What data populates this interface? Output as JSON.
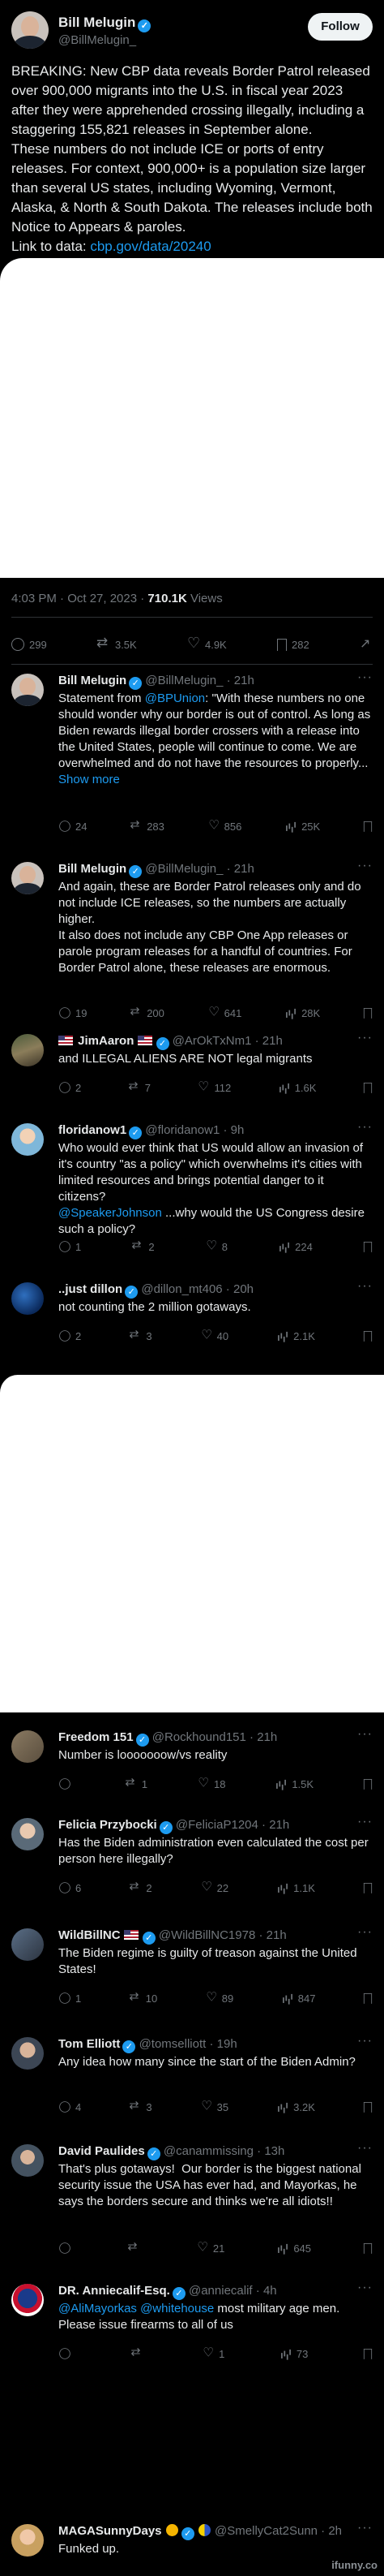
{
  "main_post": {
    "author_name": "Bill Melugin",
    "author_handle": "@BillMelugin_",
    "follow_label": "Follow",
    "text_part1": "BREAKING: New CBP data reveals Border Patrol released over 900,000 migrants into the U.S. in fiscal year 2023 after they were apprehended crossing illegally, including a staggering 155,821 releases in September alone.\nThese numbers do not include ICE or ports of entry releases. For context, 900,000+ is a population size larger than several US states, including Wyoming, Vermont, Alaska, & North & South Dakota. The releases include both Notice to Appears & paroles.\nLink to data: ",
    "link_text": "cbp.gov/data/20240",
    "timestamp": "4:03 PM · Oct 27, 2023 · ",
    "views_count": "710.1K",
    "views_label": " Views",
    "stats": {
      "replies": "299",
      "retweets": "3.5K",
      "likes": "4.9K",
      "bookmarks": "282"
    }
  },
  "replies": [
    {
      "name": "Bill Melugin",
      "handle": "@BillMelugin_",
      "time": "21h",
      "text_before": "Statement from ",
      "mention": "@BPUnion",
      "text_after": ": \"With these numbers no one should wonder why our border is out of control. As long as Biden rewards illegal border crossers with a release into the United States, people will continue to come. We are overwhelmed and do not have the resources to properly...",
      "show_more": "Show more",
      "stats": {
        "replies": "24",
        "retweets": "283",
        "likes": "856",
        "views": "25K"
      }
    },
    {
      "name": "Bill Melugin",
      "handle": "@BillMelugin_",
      "time": "21h",
      "text": "And again, these are Border Patrol releases only and do not include ICE releases, so the numbers are actually higher.\nIt also does not include any CBP One App releases or parole program releases for a handful of countries. For Border Patrol alone, these releases are enormous.",
      "stats": {
        "replies": "19",
        "retweets": "200",
        "likes": "641",
        "views": "28K"
      }
    },
    {
      "name": "JimAaron",
      "handle": "@ArOkTxNm1",
      "time": "21h",
      "text": "and ILLEGAL ALIENS ARE NOT legal migrants",
      "stats": {
        "replies": "2",
        "retweets": "7",
        "likes": "112",
        "views": "1.6K"
      }
    },
    {
      "name": "floridanow1",
      "handle": "@floridanow1",
      "time": "9h",
      "text_before": "Who would ever think that US would allow an invasion of it's country \"as a policy\" which overwhelms it's cities with limited resources and brings potential danger to it citizens?\n",
      "mention": "@SpeakerJohnson",
      "text_after": " ...why would the US Congress desire such a policy?",
      "stats": {
        "replies": "1",
        "retweets": "2",
        "likes": "8",
        "views": "224"
      }
    },
    {
      "name": "..just dillon",
      "handle": "@dillon_mt406",
      "time": "20h",
      "text": "not counting the 2 million gotaways.",
      "stats": {
        "replies": "2",
        "retweets": "3",
        "likes": "40",
        "views": "2.1K"
      }
    },
    {
      "name": "Freedom 151",
      "handle": "@Rockhound151",
      "time": "21h",
      "text": "Number is looooooow/vs reality",
      "stats": {
        "replies": "",
        "retweets": "1",
        "likes": "18",
        "views": "1.5K"
      }
    },
    {
      "name": "Felicia Przybocki",
      "handle": "@FeliciaP1204",
      "time": "21h",
      "text": "Has the Biden administration even calculated the cost per person here illegally?",
      "stats": {
        "replies": "6",
        "retweets": "2",
        "likes": "22",
        "views": "1.1K"
      }
    },
    {
      "name": "WildBillNC",
      "handle": "@WildBillNC1978",
      "time": "21h",
      "text": "The Biden regime is guilty of treason against the United States!",
      "stats": {
        "replies": "1",
        "retweets": "10",
        "likes": "89",
        "views": "847"
      }
    },
    {
      "name": "Tom Elliott",
      "handle": "@tomselliott",
      "time": "19h",
      "text": "Any idea how many since the start of the Biden Admin?",
      "stats": {
        "replies": "4",
        "retweets": "3",
        "likes": "35",
        "views": "3.2K"
      }
    },
    {
      "name": "David Paulides",
      "handle": "@canammissing",
      "time": "13h",
      "text": "That's plus gotaways!  Our border is the biggest national security issue the USA has ever had, and Mayorkas, he says the borders secure and thinks we're all idiots!!",
      "stats": {
        "replies": "",
        "retweets": "",
        "likes": "21",
        "views": "645"
      }
    },
    {
      "name": "DR. Anniecalif-Esq.",
      "handle": "@anniecalif",
      "time": "4h",
      "mention": "@AliMayorkas @whitehouse",
      "text_after": " most military age men. Please issue firearms to all of us",
      "stats": {
        "replies": "",
        "retweets": "",
        "likes": "1",
        "views": "73"
      }
    },
    {
      "name": "MAGASunnyDays",
      "handle": "@SmellyCat2Sunn",
      "time": "2h",
      "text": "Funked up."
    }
  ],
  "watermark": "ifunny.co",
  "colors": {
    "background": "#000000",
    "text": "#e7e9ea",
    "muted": "#71767b",
    "accent": "#1d9bf0",
    "divider": "#2f3336"
  }
}
